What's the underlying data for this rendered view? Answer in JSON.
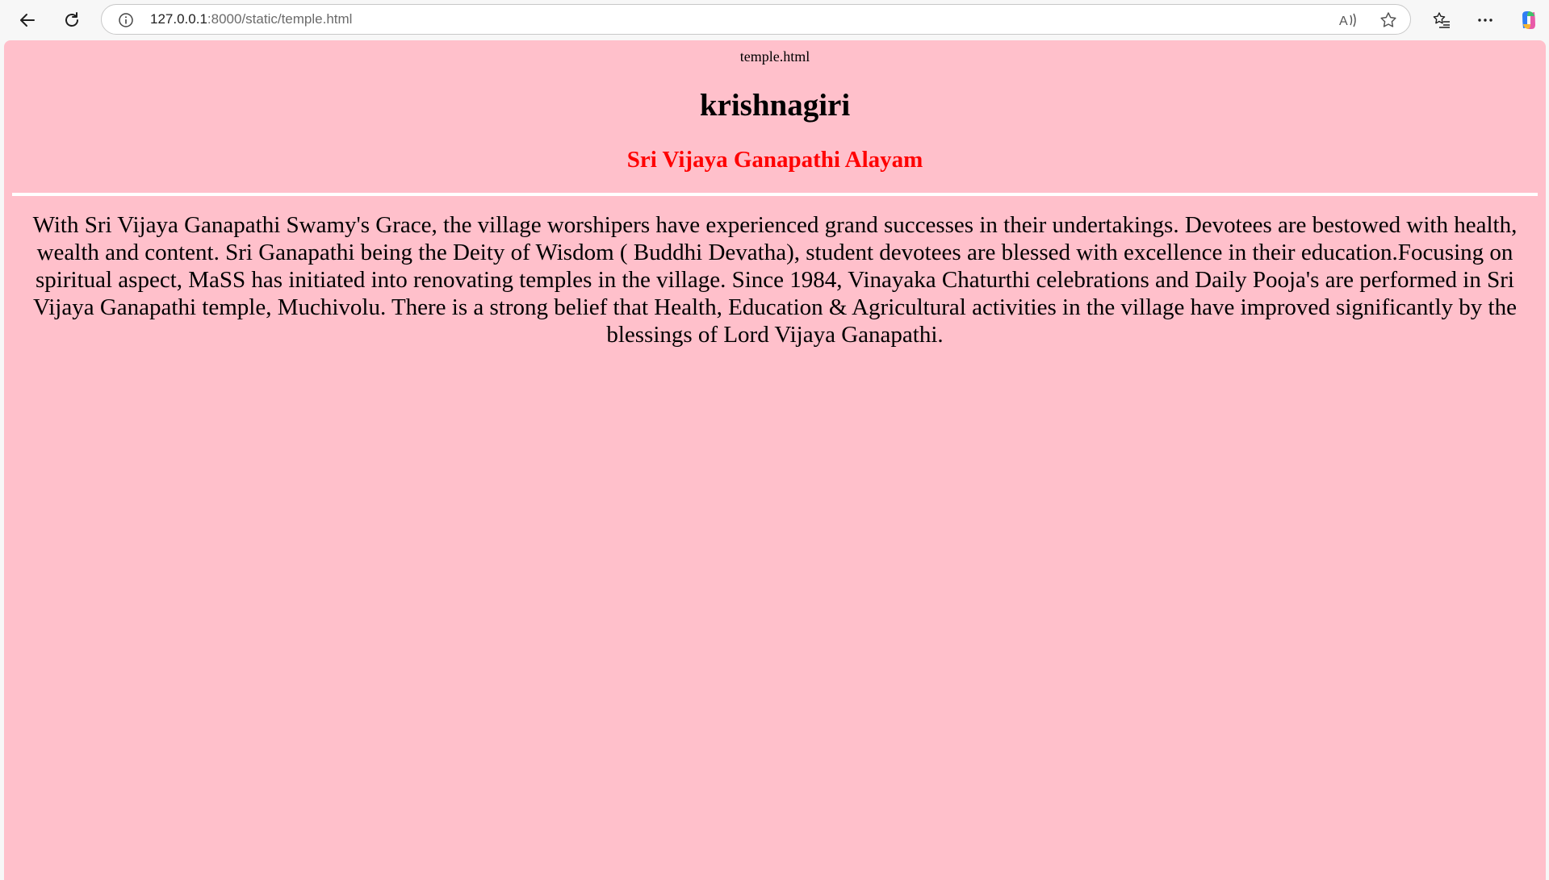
{
  "browser": {
    "url_host": "127.0.0.1",
    "url_path": ":8000/static/temple.html",
    "icons": {
      "back": "back-arrow-icon",
      "refresh": "refresh-icon",
      "info": "info-icon",
      "read_aloud": "read-aloud-icon",
      "favorite": "star-icon",
      "favorites_list": "favorites-icon",
      "menu": "more-icon",
      "copilot": "copilot-icon"
    }
  },
  "page": {
    "doc_label": "temple.html",
    "title": "krishnagiri",
    "subtitle": "Sri Vijaya Ganapathi Alayam",
    "body": "With Sri Vijaya Ganapathi Swamy's Grace, the village worshipers have experienced grand successes in their undertakings. Devotees are bestowed with health, wealth and content. Sri Ganapathi being the Deity of Wisdom ( Buddhi Devatha), student devotees are blessed with excellence in their education.Focusing on spiritual aspect, MaSS has initiated into renovating temples in the village. Since 1984, Vinayaka Chaturthi celebrations and Daily Pooja's are performed in Sri Vijaya Ganapathi temple, Muchivolu. There is a strong belief that Health, Education & Agricultural activities in the village have improved significantly by the blessings of Lord Vijaya Ganapathi."
  },
  "colors": {
    "background": "#ffc0cb",
    "subtitle": "#ff0000",
    "rule": "#ffffff"
  }
}
